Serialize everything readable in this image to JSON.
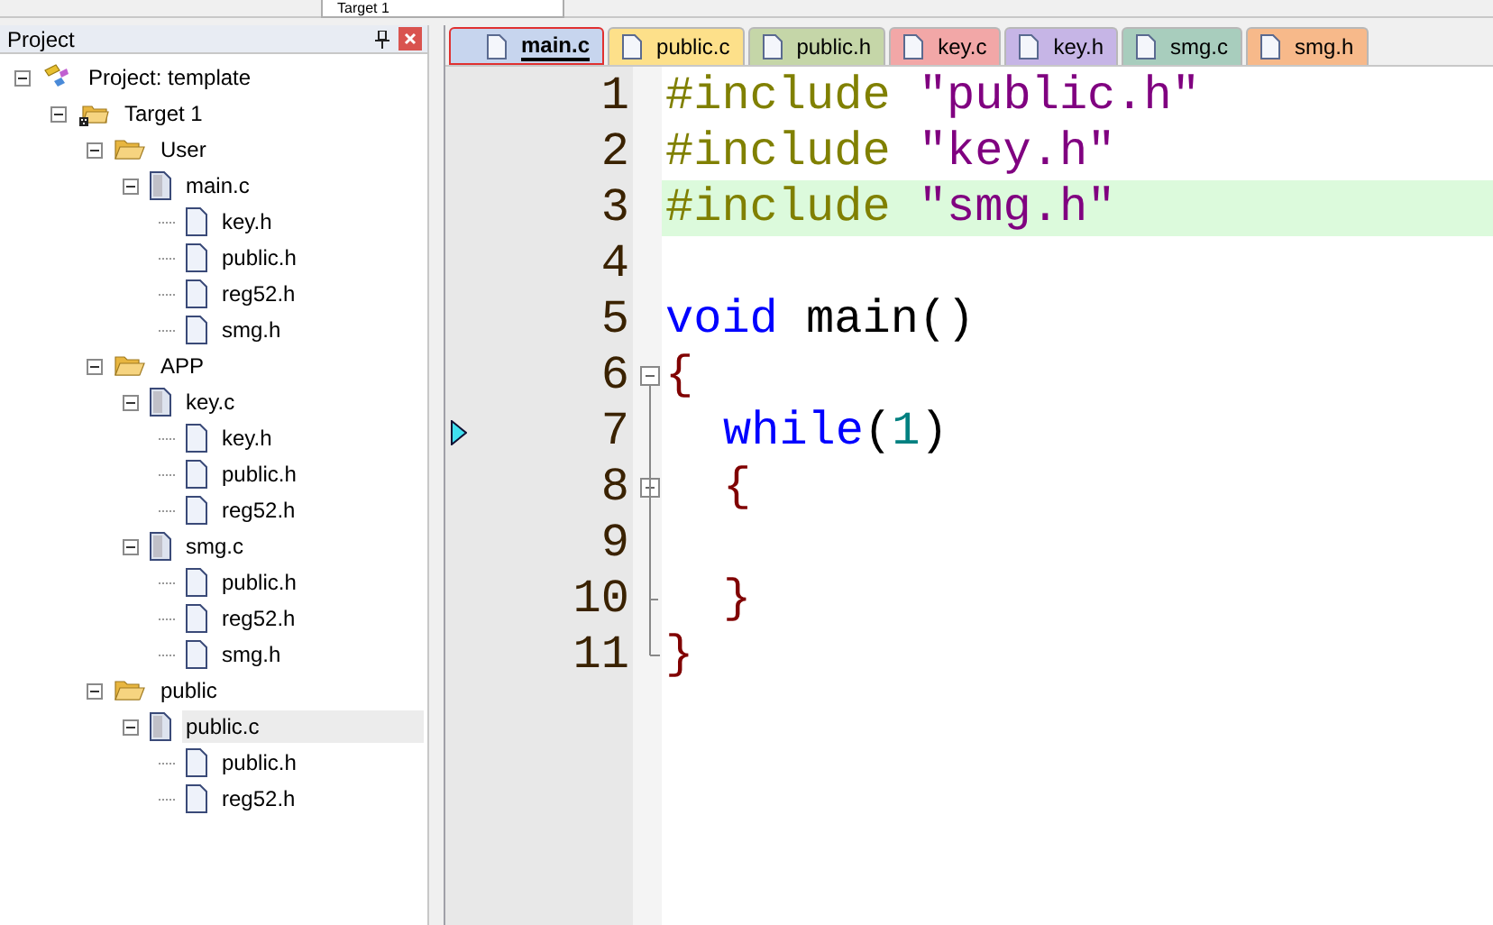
{
  "toolbar": {
    "target": "Target 1"
  },
  "project_panel": {
    "title": "Project",
    "tree": [
      {
        "label": "Project: template",
        "kind": "project",
        "expanded": true,
        "selected": false,
        "children": [
          {
            "label": "Target 1",
            "kind": "target",
            "expanded": true,
            "selected": false,
            "children": [
              {
                "label": "User",
                "kind": "folder",
                "expanded": true,
                "selected": false,
                "children": [
                  {
                    "label": "main.c",
                    "kind": "source",
                    "expanded": true,
                    "selected": false,
                    "children": [
                      {
                        "label": "key.h",
                        "kind": "header",
                        "selected": false
                      },
                      {
                        "label": "public.h",
                        "kind": "header",
                        "selected": false
                      },
                      {
                        "label": "reg52.h",
                        "kind": "header",
                        "selected": false
                      },
                      {
                        "label": "smg.h",
                        "kind": "header",
                        "selected": false
                      }
                    ]
                  }
                ]
              },
              {
                "label": "APP",
                "kind": "folder",
                "expanded": true,
                "selected": false,
                "children": [
                  {
                    "label": "key.c",
                    "kind": "source",
                    "expanded": true,
                    "selected": false,
                    "children": [
                      {
                        "label": "key.h",
                        "kind": "header",
                        "selected": false
                      },
                      {
                        "label": "public.h",
                        "kind": "header",
                        "selected": false
                      },
                      {
                        "label": "reg52.h",
                        "kind": "header",
                        "selected": false
                      }
                    ]
                  },
                  {
                    "label": "smg.c",
                    "kind": "source",
                    "expanded": true,
                    "selected": false,
                    "children": [
                      {
                        "label": "public.h",
                        "kind": "header",
                        "selected": false
                      },
                      {
                        "label": "reg52.h",
                        "kind": "header",
                        "selected": false
                      },
                      {
                        "label": "smg.h",
                        "kind": "header",
                        "selected": false
                      }
                    ]
                  }
                ]
              },
              {
                "label": "public",
                "kind": "folder",
                "expanded": true,
                "selected": false,
                "children": [
                  {
                    "label": "public.c",
                    "kind": "source",
                    "expanded": true,
                    "selected": true,
                    "children": [
                      {
                        "label": "public.h",
                        "kind": "header",
                        "selected": false
                      },
                      {
                        "label": "reg52.h",
                        "kind": "header",
                        "selected": false
                      }
                    ]
                  }
                ]
              }
            ]
          }
        ]
      }
    ]
  },
  "tabs": [
    {
      "label": "main.c",
      "color": "#c7d5ee",
      "selected": true
    },
    {
      "label": "public.c",
      "color": "#fde08a",
      "selected": false
    },
    {
      "label": "public.h",
      "color": "#c5d6a8",
      "selected": false
    },
    {
      "label": "key.c",
      "color": "#f2a7a7",
      "selected": false
    },
    {
      "label": "key.h",
      "color": "#c6b5e6",
      "selected": false
    },
    {
      "label": "smg.c",
      "color": "#a8cdbd",
      "selected": false
    },
    {
      "label": "smg.h",
      "color": "#f7b98a",
      "selected": false
    }
  ],
  "editor": {
    "lines": [
      {
        "number": "1",
        "tokens": [
          {
            "kind": "preproc",
            "text": "#include "
          },
          {
            "kind": "string",
            "text": "\"public.h\""
          }
        ]
      },
      {
        "number": "2",
        "tokens": [
          {
            "kind": "preproc",
            "text": "#include "
          },
          {
            "kind": "string",
            "text": "\"key.h\""
          }
        ]
      },
      {
        "number": "3",
        "highlighted": true,
        "tokens": [
          {
            "kind": "preproc",
            "text": "#include "
          },
          {
            "kind": "string",
            "text": "\"smg.h\""
          }
        ]
      },
      {
        "number": "4"
      },
      {
        "number": "5",
        "tokens": [
          {
            "kind": "keyword",
            "text": "void"
          },
          {
            "kind": "plain",
            "text": " main()"
          }
        ]
      },
      {
        "number": "6",
        "fold_start": true,
        "tokens": [
          {
            "kind": "brace",
            "text": "{"
          }
        ]
      },
      {
        "number": "7",
        "marker": true,
        "indented": true,
        "tokens": [
          {
            "kind": "keyword",
            "text": "while"
          },
          {
            "kind": "plain",
            "text": "("
          },
          {
            "kind": "number",
            "text": "1"
          },
          {
            "kind": "plain",
            "text": ")"
          }
        ]
      },
      {
        "number": "8",
        "fold_start": true,
        "indented": true,
        "tokens": [
          {
            "kind": "brace",
            "text": "{"
          }
        ]
      },
      {
        "number": "9"
      },
      {
        "number": "10",
        "fold_end": true,
        "indented": true,
        "tokens": [
          {
            "kind": "brace",
            "text": "}"
          }
        ]
      },
      {
        "number": "11",
        "fold_end": true,
        "tokens": [
          {
            "kind": "brace",
            "text": "}"
          }
        ]
      }
    ]
  }
}
